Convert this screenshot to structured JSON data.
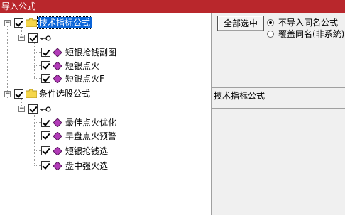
{
  "window": {
    "title": "导入公式"
  },
  "tree": {
    "groups": [
      {
        "label": "技术指标公式",
        "selected": true,
        "items": [
          "短银抢钱副图",
          "短银点火",
          "短银点火F"
        ]
      },
      {
        "label": "条件选股公式",
        "selected": false,
        "items": [
          "最佳点火优化",
          "早盘点火预警",
          "短银抢钱选",
          "盘中强火选"
        ]
      }
    ]
  },
  "right_panel": {
    "select_all_label": "全部选中",
    "options": [
      {
        "label": "不导入同名公式",
        "checked": true
      },
      {
        "label": "覆盖同名(非系统)",
        "checked": false
      }
    ],
    "info_title": "技术指标公式"
  },
  "colors": {
    "titlebar": "#b9272c",
    "selection": "#0a64d8",
    "folder": "#f5d64a",
    "leaf": "#b23bb8"
  }
}
